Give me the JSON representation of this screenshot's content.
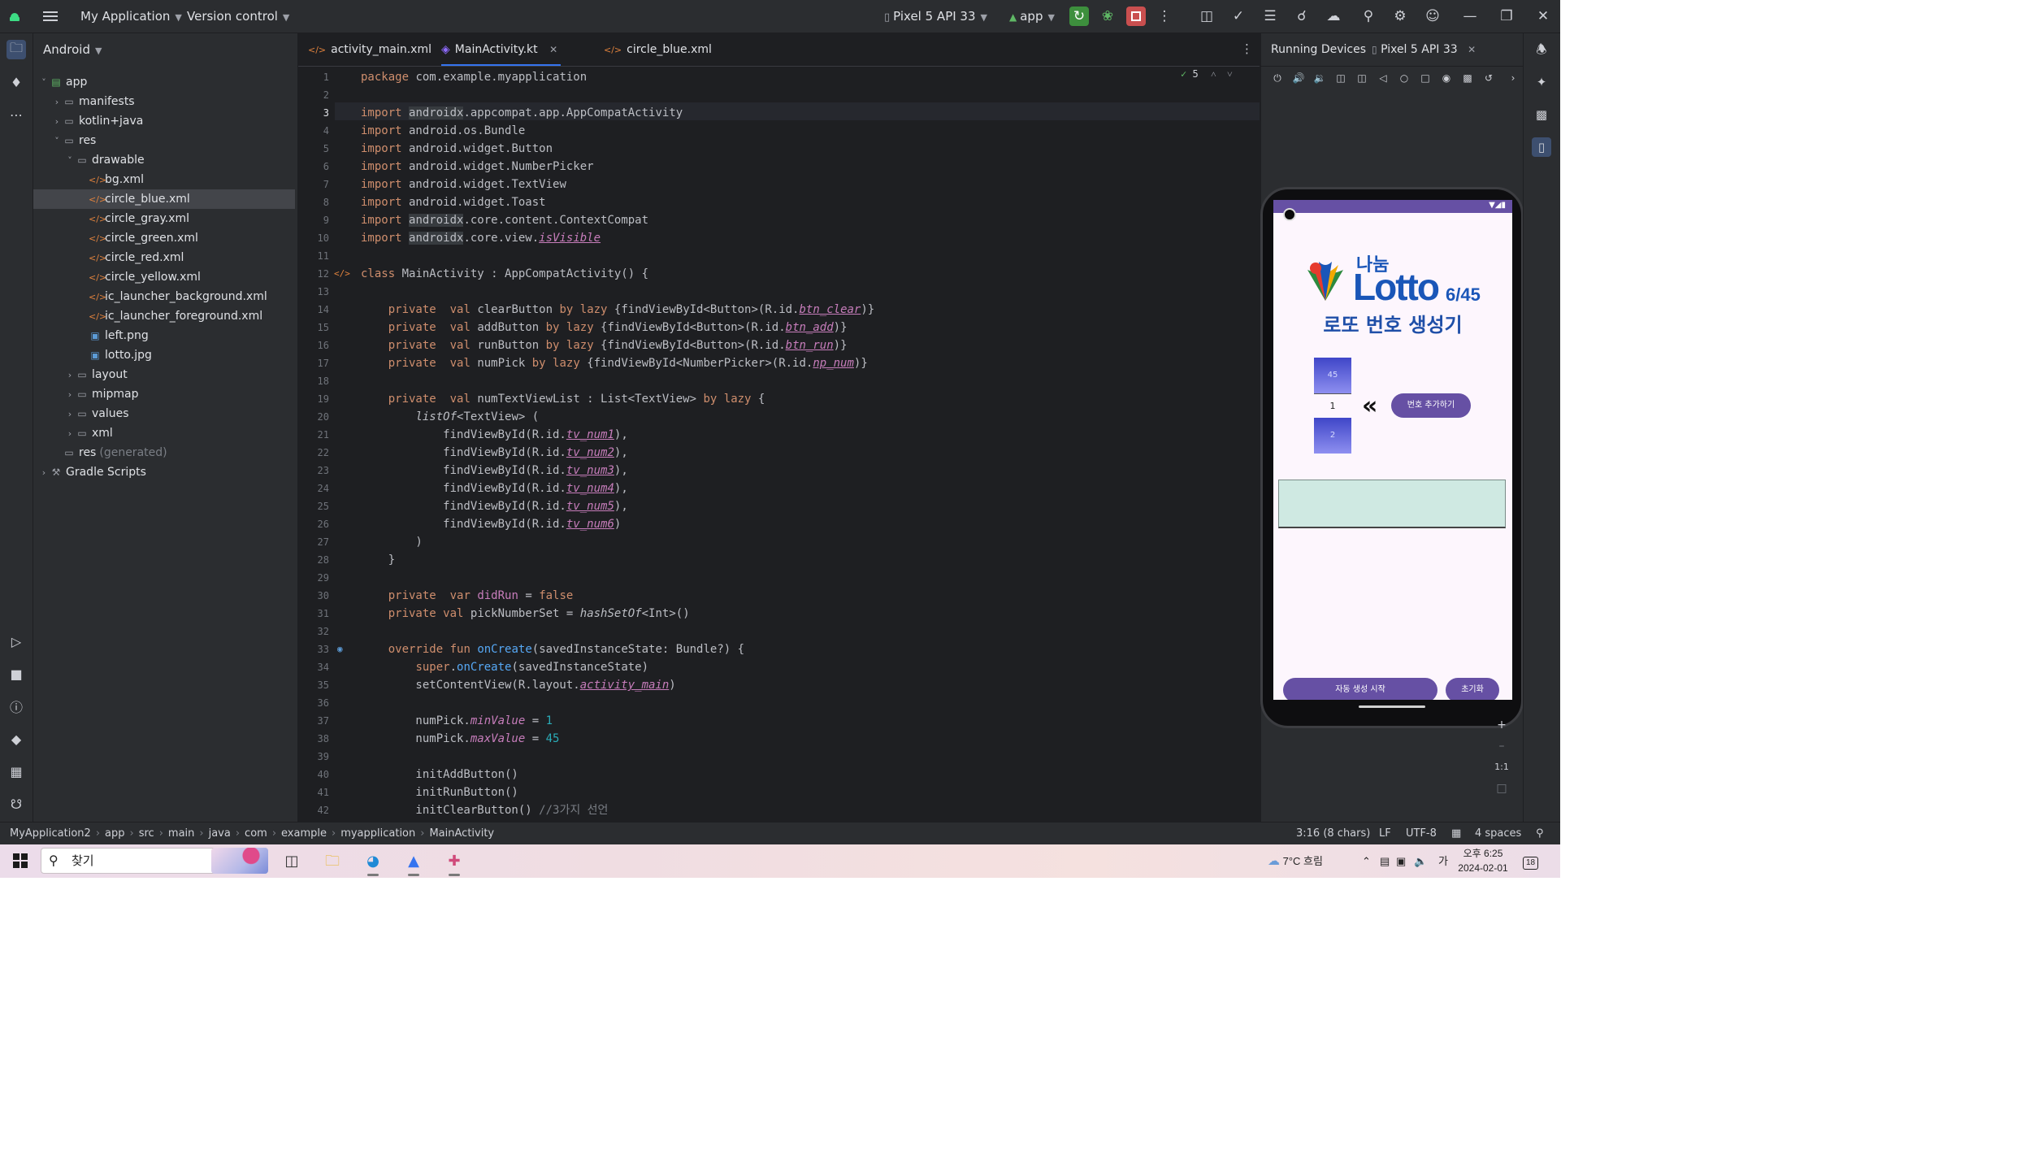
{
  "titlebar": {
    "project": "My Application",
    "vcs": "Version control",
    "device": "Pixel 5 API 33",
    "run_config": "app"
  },
  "project_panel": {
    "view": "Android",
    "tree": [
      {
        "label": "app",
        "depth": 0,
        "kind": "module",
        "expanded": true
      },
      {
        "label": "manifests",
        "depth": 1,
        "kind": "folder",
        "expanded": false
      },
      {
        "label": "kotlin+java",
        "depth": 1,
        "kind": "folder",
        "expanded": false
      },
      {
        "label": "res",
        "depth": 1,
        "kind": "folder",
        "expanded": true
      },
      {
        "label": "drawable",
        "depth": 2,
        "kind": "folder",
        "expanded": true
      },
      {
        "label": "bg.xml",
        "depth": 3,
        "kind": "xml"
      },
      {
        "label": "circle_blue.xml",
        "depth": 3,
        "kind": "xml",
        "selected": true
      },
      {
        "label": "circle_gray.xml",
        "depth": 3,
        "kind": "xml"
      },
      {
        "label": "circle_green.xml",
        "depth": 3,
        "kind": "xml"
      },
      {
        "label": "circle_red.xml",
        "depth": 3,
        "kind": "xml"
      },
      {
        "label": "circle_yellow.xml",
        "depth": 3,
        "kind": "xml"
      },
      {
        "label": "ic_launcher_background.xml",
        "depth": 3,
        "kind": "xml"
      },
      {
        "label": "ic_launcher_foreground.xml",
        "depth": 3,
        "kind": "xml"
      },
      {
        "label": "left.png",
        "depth": 3,
        "kind": "image"
      },
      {
        "label": "lotto.jpg",
        "depth": 3,
        "kind": "image"
      },
      {
        "label": "layout",
        "depth": 2,
        "kind": "folder",
        "expanded": false
      },
      {
        "label": "mipmap",
        "depth": 2,
        "kind": "folder",
        "expanded": false
      },
      {
        "label": "values",
        "depth": 2,
        "kind": "folder",
        "expanded": false
      },
      {
        "label": "xml",
        "depth": 2,
        "kind": "folder",
        "expanded": false
      },
      {
        "label": "res",
        "suffix": "(generated)",
        "depth": 1,
        "kind": "folder-plain"
      },
      {
        "label": "Gradle Scripts",
        "depth": 0,
        "kind": "gradle",
        "expanded": false
      }
    ]
  },
  "editor": {
    "tabs": [
      {
        "label": "activity_main.xml",
        "icon": "xml-icon",
        "active": false
      },
      {
        "label": "MainActivity.kt",
        "icon": "kotlin-icon",
        "active": true
      },
      {
        "label": "circle_blue.xml",
        "icon": "xml-icon",
        "active": false
      }
    ],
    "inspection_count": "5",
    "current_line": 3,
    "lines": [
      "package com.example.myapplication",
      "",
      "import androidx.appcompat.app.AppCompatActivity",
      "import android.os.Bundle",
      "import android.widget.Button",
      "import android.widget.NumberPicker",
      "import android.widget.TextView",
      "import android.widget.Toast",
      "import androidx.core.content.ContextCompat",
      "import androidx.core.view.isVisible",
      "",
      "class MainActivity : AppCompatActivity() {",
      "",
      "    private  val clearButton by lazy {findViewById<Button>(R.id.btn_clear)}",
      "    private  val addButton by lazy {findViewById<Button>(R.id.btn_add)}",
      "    private  val runButton by lazy {findViewById<Button>(R.id.btn_run)}",
      "    private  val numPick by lazy {findViewById<NumberPicker>(R.id.np_num)}",
      "",
      "    private  val numTextViewList : List<TextView> by lazy {",
      "        listOf<TextView> (",
      "            findViewById(R.id.tv_num1),",
      "            findViewById(R.id.tv_num2),",
      "            findViewById(R.id.tv_num3),",
      "            findViewById(R.id.tv_num4),",
      "            findViewById(R.id.tv_num5),",
      "            findViewById(R.id.tv_num6)",
      "        )",
      "    }",
      "",
      "    private  var didRun = false",
      "    private val pickNumberSet = hashSetOf<Int>()",
      "",
      "    override fun onCreate(savedInstanceState: Bundle?) {",
      "        super.onCreate(savedInstanceState)",
      "        setContentView(R.layout.activity_main)",
      "",
      "        numPick.minValue = 1",
      "        numPick.maxValue = 45",
      "",
      "        initAddButton()",
      "        initRunButton()",
      "        initClearButton() //3가지 선언"
    ]
  },
  "devices": {
    "panel_title": "Running Devices",
    "device_tab": "Pixel 5 API 33",
    "zoom_label": "1:1"
  },
  "app": {
    "logo_text_top": "나눔",
    "logo_text": "Lotto",
    "logo_suffix": "6/45",
    "title": "로또 번호 생성기",
    "picker_above": "45",
    "picker_value": "1",
    "picker_below": "2",
    "add_button": "번호 추가하기",
    "run_button": "자동 생성 시작",
    "clear_button": "초기화"
  },
  "statusbar": {
    "breadcrumbs": [
      "MyApplication2",
      "app",
      "src",
      "main",
      "java",
      "com",
      "example",
      "myapplication",
      "MainActivity"
    ],
    "position": "3:16 (8 chars)",
    "line_sep": "LF",
    "encoding": "UTF-8",
    "indent": "4 spaces"
  },
  "taskbar": {
    "search_placeholder": "찾기",
    "weather": "7°C  흐림",
    "ime": "가",
    "time": "오후 6:25",
    "date": "2024-02-01",
    "notifications": "18"
  },
  "colors": {
    "ide_bg": "#1e1f22",
    "panel_bg": "#2b2d30",
    "accent": "#3574f0",
    "app_primary": "#6650a4",
    "app_title": "#1f4fa8"
  }
}
